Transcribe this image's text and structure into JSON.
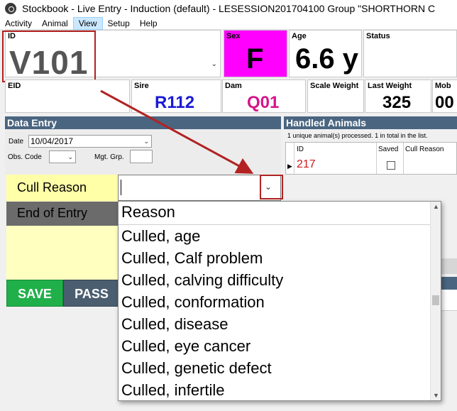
{
  "window": {
    "title": "Stockbook - Live Entry - Induction (default) - LESESSION201704100 Group \"SHORTHORN C"
  },
  "menu": [
    "Activity",
    "Animal",
    "View",
    "Setup",
    "Help"
  ],
  "animal": {
    "id_label": "ID",
    "id_value": "V101",
    "sex_label": "Sex",
    "sex_value": "F",
    "age_label": "Age",
    "age_value": "6.6 y",
    "status_label": "Status",
    "eid_label": "EID",
    "sire_label": "Sire",
    "sire_value": "R112",
    "dam_label": "Dam",
    "dam_value": "Q01",
    "scale_weight_label": "Scale Weight",
    "last_weight_label": "Last Weight",
    "last_weight_value": "325",
    "mob_label": "Mob",
    "mob_value": "00"
  },
  "data_entry": {
    "header": "Data Entry",
    "date_label": "Date",
    "date_value": "10/04/2017",
    "obs_code_label": "Obs. Code",
    "mgt_grp_label": "Mgt. Grp.",
    "cull_reason_label": "Cull Reason",
    "end_of_entry_label": "End of Entry",
    "save_label": "SAVE",
    "pass_label": "PASS"
  },
  "handled": {
    "header": "Handled Animals",
    "summary": "1 unique animal(s) processed. 1 in total in the list.",
    "columns": [
      "ID",
      "Saved",
      "Cull Reason"
    ],
    "rows": [
      {
        "id": "217",
        "saved": false,
        "cull_reason": ""
      }
    ]
  },
  "dropdown": {
    "header": "Reason",
    "items": [
      "Culled, age",
      "Culled, Calf problem",
      "Culled, calving difficulty",
      "Culled, conformation",
      "Culled, disease",
      "Culled, eye cancer",
      "Culled, genetic defect",
      "Culled, infertile"
    ]
  },
  "colors": {
    "sex_highlight": "#ff00ff",
    "sire_text": "#1a1ad6",
    "dam_text": "#d6158a",
    "header_bar": "#4a6580",
    "save_button": "#20b04a",
    "annotation": "#b22222"
  }
}
